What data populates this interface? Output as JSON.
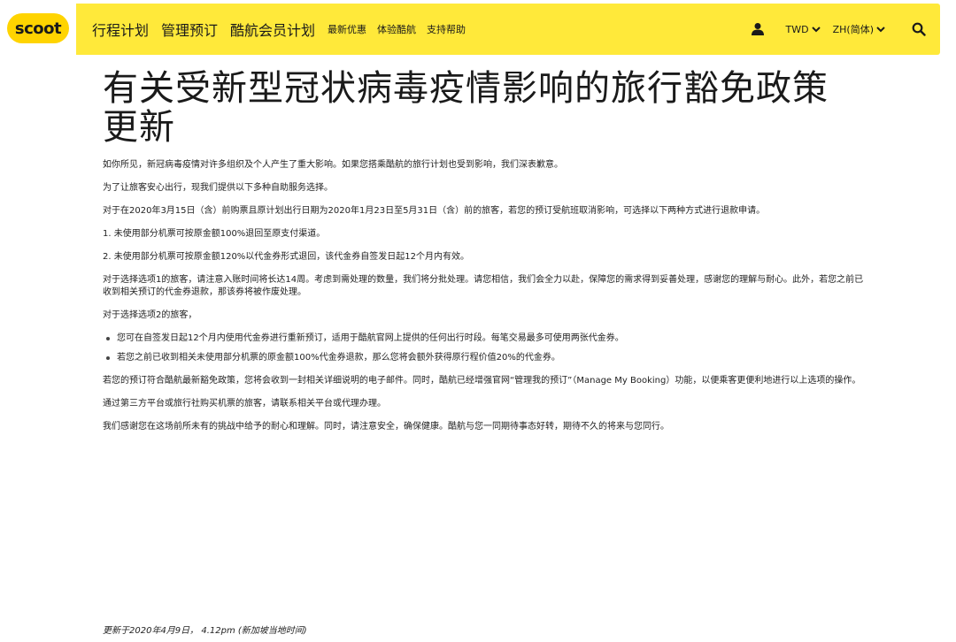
{
  "nav": {
    "logo": "scoot",
    "main_links": [
      "行程计划",
      "管理预订",
      "酷航会员计划"
    ],
    "sub_links": [
      "最新优惠",
      "体验酷航",
      "支持帮助"
    ],
    "currency": "TWD",
    "language": "ZH(简体)",
    "icons": {
      "user": "user-icon",
      "search": "search-icon",
      "chevron": "chevron-down-icon"
    }
  },
  "colors": {
    "brand_yellow": "#ffe93a",
    "logo_yellow": "#ffd400",
    "text": "#1a1a1a"
  },
  "article": {
    "title": "有关受新型冠状病毒疫情影响的旅行豁免政策更新",
    "paragraphs_before": [
      "如你所见，新冠病毒疫情对许多组织及个人产生了重大影响。如果您搭乘酷航的旅行计划也受到影响，我们深表歉意。",
      "为了让旅客安心出行，现我们提供以下多种自助服务选择。",
      "对于在2020年3月15日（含）前购票且原计划出行日期为2020年1月23日至5月31日（含）前的旅客，若您的预订受航班取消影响，可选择以下两种方式进行退款申请。",
      "1. 未使用部分机票可按原金额100%退回至原支付渠道。",
      "2. 未使用部分机票可按原金额120%以代金券形式退回，该代金券自签发日起12个月内有效。",
      "对于选择选项1的旅客，请注意入账时间将长达14周。考虑到需处理的数量，我们将分批处理。请您相信，我们会全力以赴，保障您的需求得到妥善处理，感谢您的理解与耐心。此外，若您之前已收到相关预订的代金券退款，那该券将被作废处理。",
      "对于选择选项2的旅客，"
    ],
    "bullets": [
      "您可在自签发日起12个月内使用代金券进行重新预订，适用于酷航官网上提供的任何出行时段。每笔交易最多可使用两张代金券。",
      "若您之前已收到相关未使用部分机票的原金额100%代金券退款，那么您将会额外获得原行程价值20%的代金券。"
    ],
    "paragraphs_after": [
      "若您的预订符合酷航最新豁免政策，您将会收到一封相关详细说明的电子邮件。同时，酷航已经增强官网“管理我的预订”（Manage My Booking）功能，以便乘客更便利地进行以上选项的操作。",
      "通过第三方平台或旅行社购买机票的旅客，请联系相关平台或代理办理。",
      "我们感谢您在这场前所未有的挑战中给予的耐心和理解。同时，请注意安全，确保健康。酷航与您一同期待事态好转，期待不久的将来与您同行。"
    ],
    "updated": "更新于2020年4月9日， 4.12pm (新加坡当地时间)"
  }
}
